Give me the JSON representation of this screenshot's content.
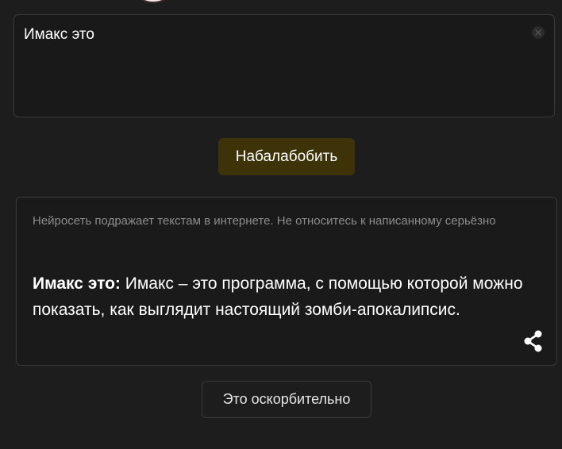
{
  "prompt": {
    "value": "Имакс это"
  },
  "generate_button": {
    "label": "Набалабобить"
  },
  "result": {
    "disclaimer": "Нейросеть подражает текстам в интернете. Не относитесь к написанному серьёзно",
    "prefix": "Имакс это:",
    "body": " Имакс – это программа, с помощью которой можно показать, как выглядит настоящий зомби-апокалипсис."
  },
  "report_button": {
    "label": "Это оскорбительно"
  },
  "icons": {
    "clear": "clear-icon",
    "share": "share-icon"
  },
  "colors": {
    "background": "#1d1d1d",
    "generate_button_bg": "#3d3208",
    "disclaimer_text": "#8c8c8c"
  }
}
